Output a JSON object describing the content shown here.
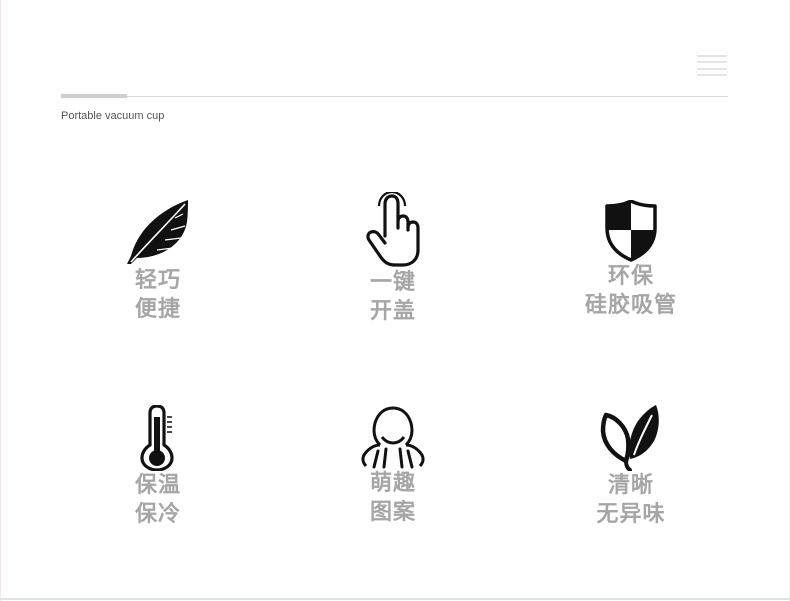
{
  "header": {
    "subtitle": "Portable vacuum cup"
  },
  "features": [
    {
      "icon": "feather-icon",
      "line1": "轻巧",
      "line2": "便捷"
    },
    {
      "icon": "hand-pointer-icon",
      "line1": "一键",
      "line2": "开盖"
    },
    {
      "icon": "shield-icon",
      "line1": "环保",
      "line2": "硅胶吸管"
    },
    {
      "icon": "thermometer-icon",
      "line1": "保温",
      "line2": "保冷"
    },
    {
      "icon": "cute-face-icon",
      "line1": "萌趣",
      "line2": "图案"
    },
    {
      "icon": "leaf-icon",
      "line1": "清晰",
      "line2": "无异味"
    }
  ],
  "colors": {
    "label": "#a6a6a6",
    "icon": "#111111",
    "divider": "#d9d9d9"
  }
}
